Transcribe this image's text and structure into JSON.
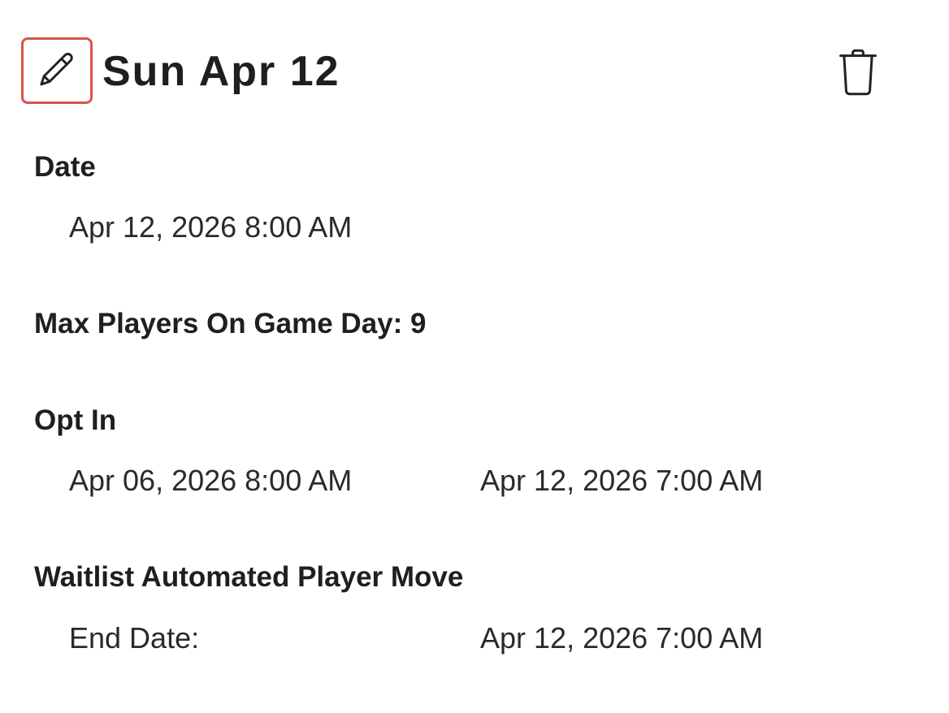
{
  "header": {
    "title": "Sun Apr 12",
    "edit_icon": "pencil-icon",
    "delete_icon": "trash-icon",
    "edit_highlight_color": "#d9534f"
  },
  "date_section": {
    "heading": "Date",
    "value": "Apr 12, 2026 8:00 AM"
  },
  "max_players": {
    "label": "Max Players On Game Day: 9"
  },
  "opt_in": {
    "heading": "Opt In",
    "start": "Apr 06, 2026 8:00 AM",
    "end": "Apr 12, 2026 7:00 AM"
  },
  "waitlist": {
    "heading": "Waitlist Automated Player Move",
    "end_date_label": "End Date:",
    "end_date_value": "Apr 12, 2026 7:00 AM"
  }
}
